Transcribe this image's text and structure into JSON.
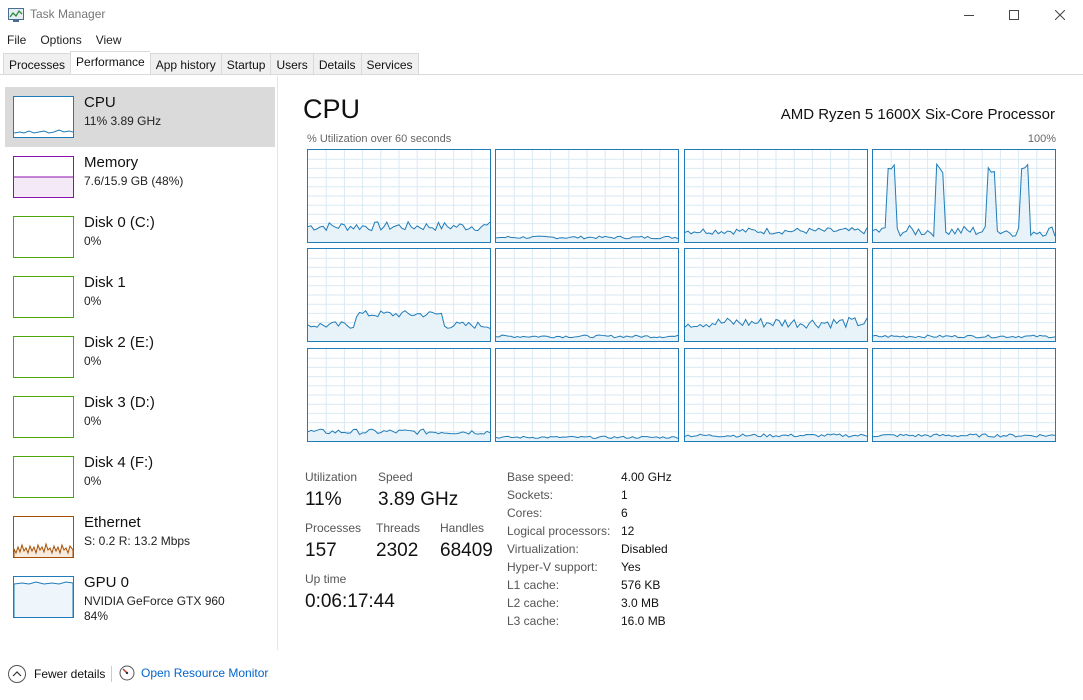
{
  "window": {
    "title": "Task Manager"
  },
  "menu": [
    "File",
    "Options",
    "View"
  ],
  "tabs": [
    "Processes",
    "Performance",
    "App history",
    "Startup",
    "Users",
    "Details",
    "Services"
  ],
  "sidebar": [
    {
      "name": "CPU",
      "sub": "11% 3.89 GHz",
      "color": "#1f7cb8"
    },
    {
      "name": "Memory",
      "sub": "7.6/15.9 GB (48%)",
      "color": "#8b12ae"
    },
    {
      "name": "Disk 0 (C:)",
      "sub": "0%",
      "color": "#4da60c"
    },
    {
      "name": "Disk 1",
      "sub": "0%",
      "color": "#4da60c"
    },
    {
      "name": "Disk 2 (E:)",
      "sub": "0%",
      "color": "#4da60c"
    },
    {
      "name": "Disk 3 (D:)",
      "sub": "0%",
      "color": "#4da60c"
    },
    {
      "name": "Disk 4 (F:)",
      "sub": "0%",
      "color": "#4da60c"
    },
    {
      "name": "Ethernet",
      "sub": "S: 0.2 R: 13.2 Mbps",
      "color": "#a74f01"
    },
    {
      "name": "GPU 0",
      "sub": "NVIDIA GeForce GTX 960",
      "sub2": "84%",
      "color": "#1f7cb8"
    }
  ],
  "main": {
    "title": "CPU",
    "processor": "AMD Ryzen 5 1600X Six-Core Processor",
    "caption": "% Utilization over 60 seconds",
    "max": "100%",
    "core_levels": [
      0.17,
      0.05,
      0.12,
      0.55,
      0.22,
      0.05,
      0.2,
      0.05,
      0.1,
      0.04,
      0.06,
      0.06
    ]
  },
  "stats": {
    "utilization_label": "Utilization",
    "utilization": "11%",
    "speed_label": "Speed",
    "speed": "3.89 GHz",
    "processes_label": "Processes",
    "processes": "157",
    "threads_label": "Threads",
    "threads": "2302",
    "handles_label": "Handles",
    "handles": "68409",
    "uptime_label": "Up time",
    "uptime": "0:06:17:44"
  },
  "details": [
    {
      "label": "Base speed:",
      "value": "4.00 GHz"
    },
    {
      "label": "Sockets:",
      "value": "1"
    },
    {
      "label": "Cores:",
      "value": "6"
    },
    {
      "label": "Logical processors:",
      "value": "12"
    },
    {
      "label": "Virtualization:",
      "value": "Disabled"
    },
    {
      "label": "Hyper-V support:",
      "value": "Yes"
    },
    {
      "label": "L1 cache:",
      "value": "576 KB"
    },
    {
      "label": "L2 cache:",
      "value": "3.0 MB"
    },
    {
      "label": "L3 cache:",
      "value": "16.0 MB"
    }
  ],
  "footer": {
    "fewer": "Fewer details",
    "resmon": "Open Resource Monitor"
  },
  "colors": {
    "cpu": "#1f7cb8",
    "grid": "#d9eaf4",
    "fill": "#e8f2f9"
  }
}
